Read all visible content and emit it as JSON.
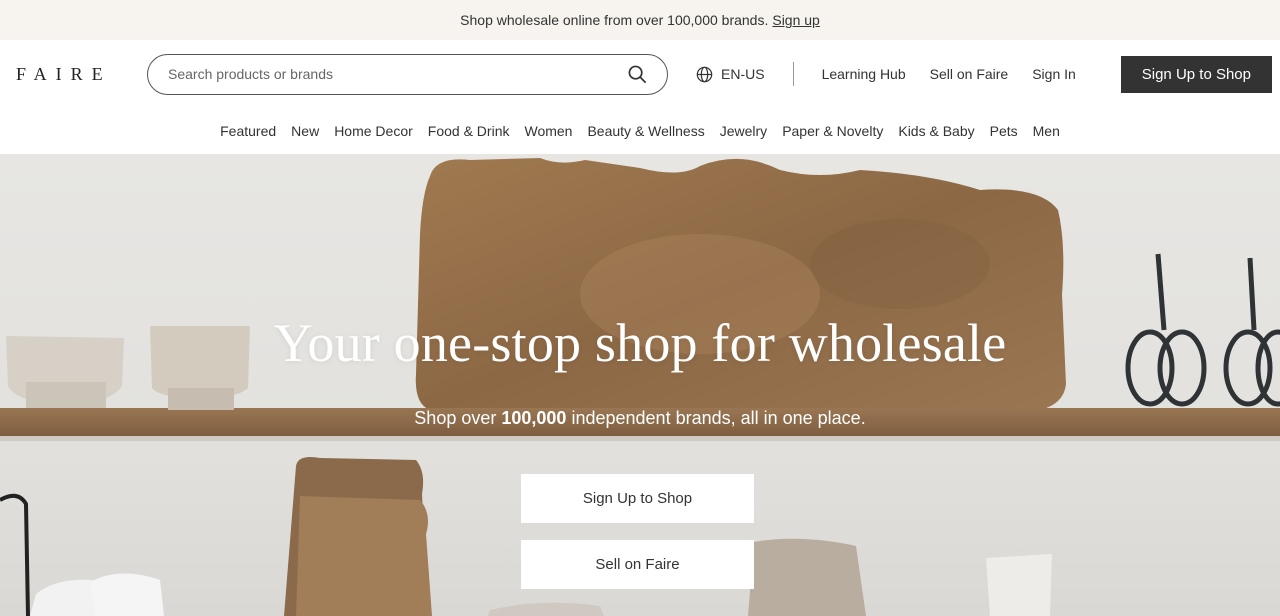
{
  "promo": {
    "text": "Shop wholesale online from over 100,000 brands.",
    "link": "Sign up"
  },
  "header": {
    "logo": "FAIRE",
    "search_placeholder": "Search products or brands",
    "language": "EN-US",
    "links": [
      "Learning Hub",
      "Sell on Faire",
      "Sign In"
    ],
    "cta": "Sign Up to Shop"
  },
  "categories": [
    "Featured",
    "New",
    "Home Decor",
    "Food & Drink",
    "Women",
    "Beauty & Wellness",
    "Jewelry",
    "Paper & Novelty",
    "Kids & Baby",
    "Pets",
    "Men"
  ],
  "hero": {
    "title": "Your one-stop shop for wholesale",
    "subtitle_prefix": "Shop over",
    "subtitle_bold": "100,000",
    "subtitle_suffix": "independent brands, all in one place.",
    "primary_button": "Sign Up to Shop",
    "secondary_button": "Sell on Faire"
  },
  "colors": {
    "dark": "#333333",
    "promo_bg": "#f7f4f0",
    "wood": "#9a7450"
  },
  "icons": {
    "search": "search-icon",
    "language": "globe-icon"
  }
}
